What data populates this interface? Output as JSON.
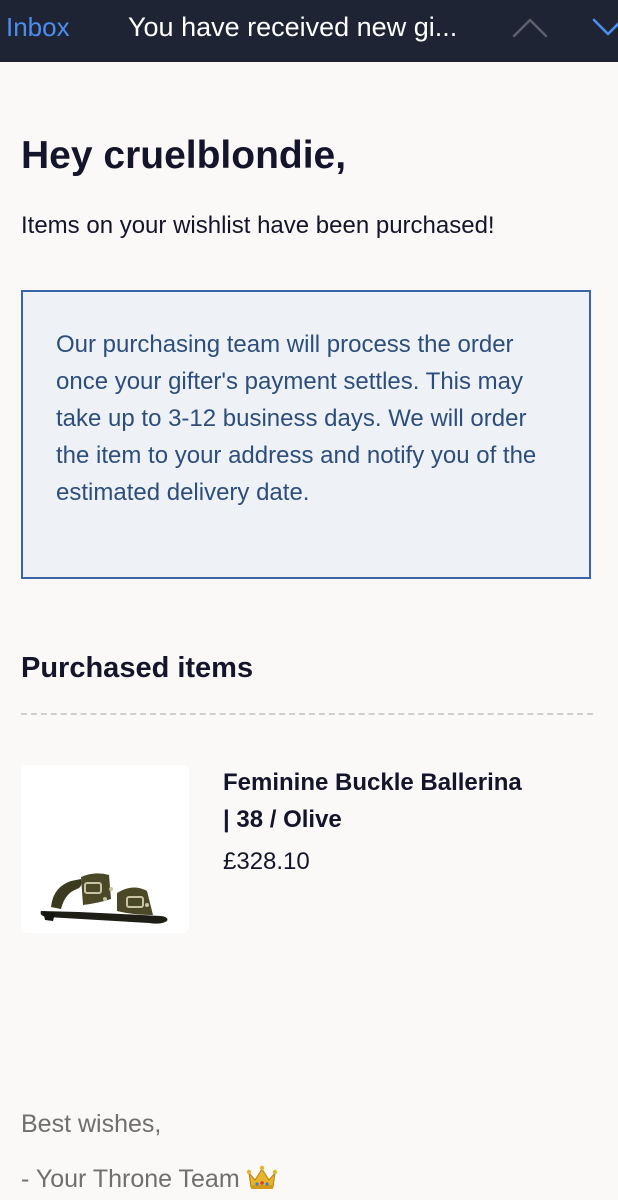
{
  "nav": {
    "back_label": "Inbox",
    "subject": "You have received new gi..."
  },
  "email": {
    "greeting": "Hey cruelblondie,",
    "intro": "Items on your wishlist have been purchased!",
    "notice": "Our purchasing team will process the order once your gifter's payment settles. This may take up to 3-12 business days. We will order the item to your address and notify you of the estimated delivery date.",
    "section_title": "Purchased items",
    "items": [
      {
        "name": "Feminine Buckle Ballerina | 38 / Olive",
        "price": "£328.10"
      }
    ],
    "signoff": "Best wishes,",
    "signature": "- Your Throne Team"
  },
  "colors": {
    "nav_background": "#1e2433",
    "accent": "#4b8ef0",
    "notice_border": "#3a66a8",
    "notice_text": "#2d4e7c"
  },
  "icons": {
    "up": "chevron-up-icon",
    "down": "chevron-down-icon",
    "crown": "crown-icon"
  }
}
